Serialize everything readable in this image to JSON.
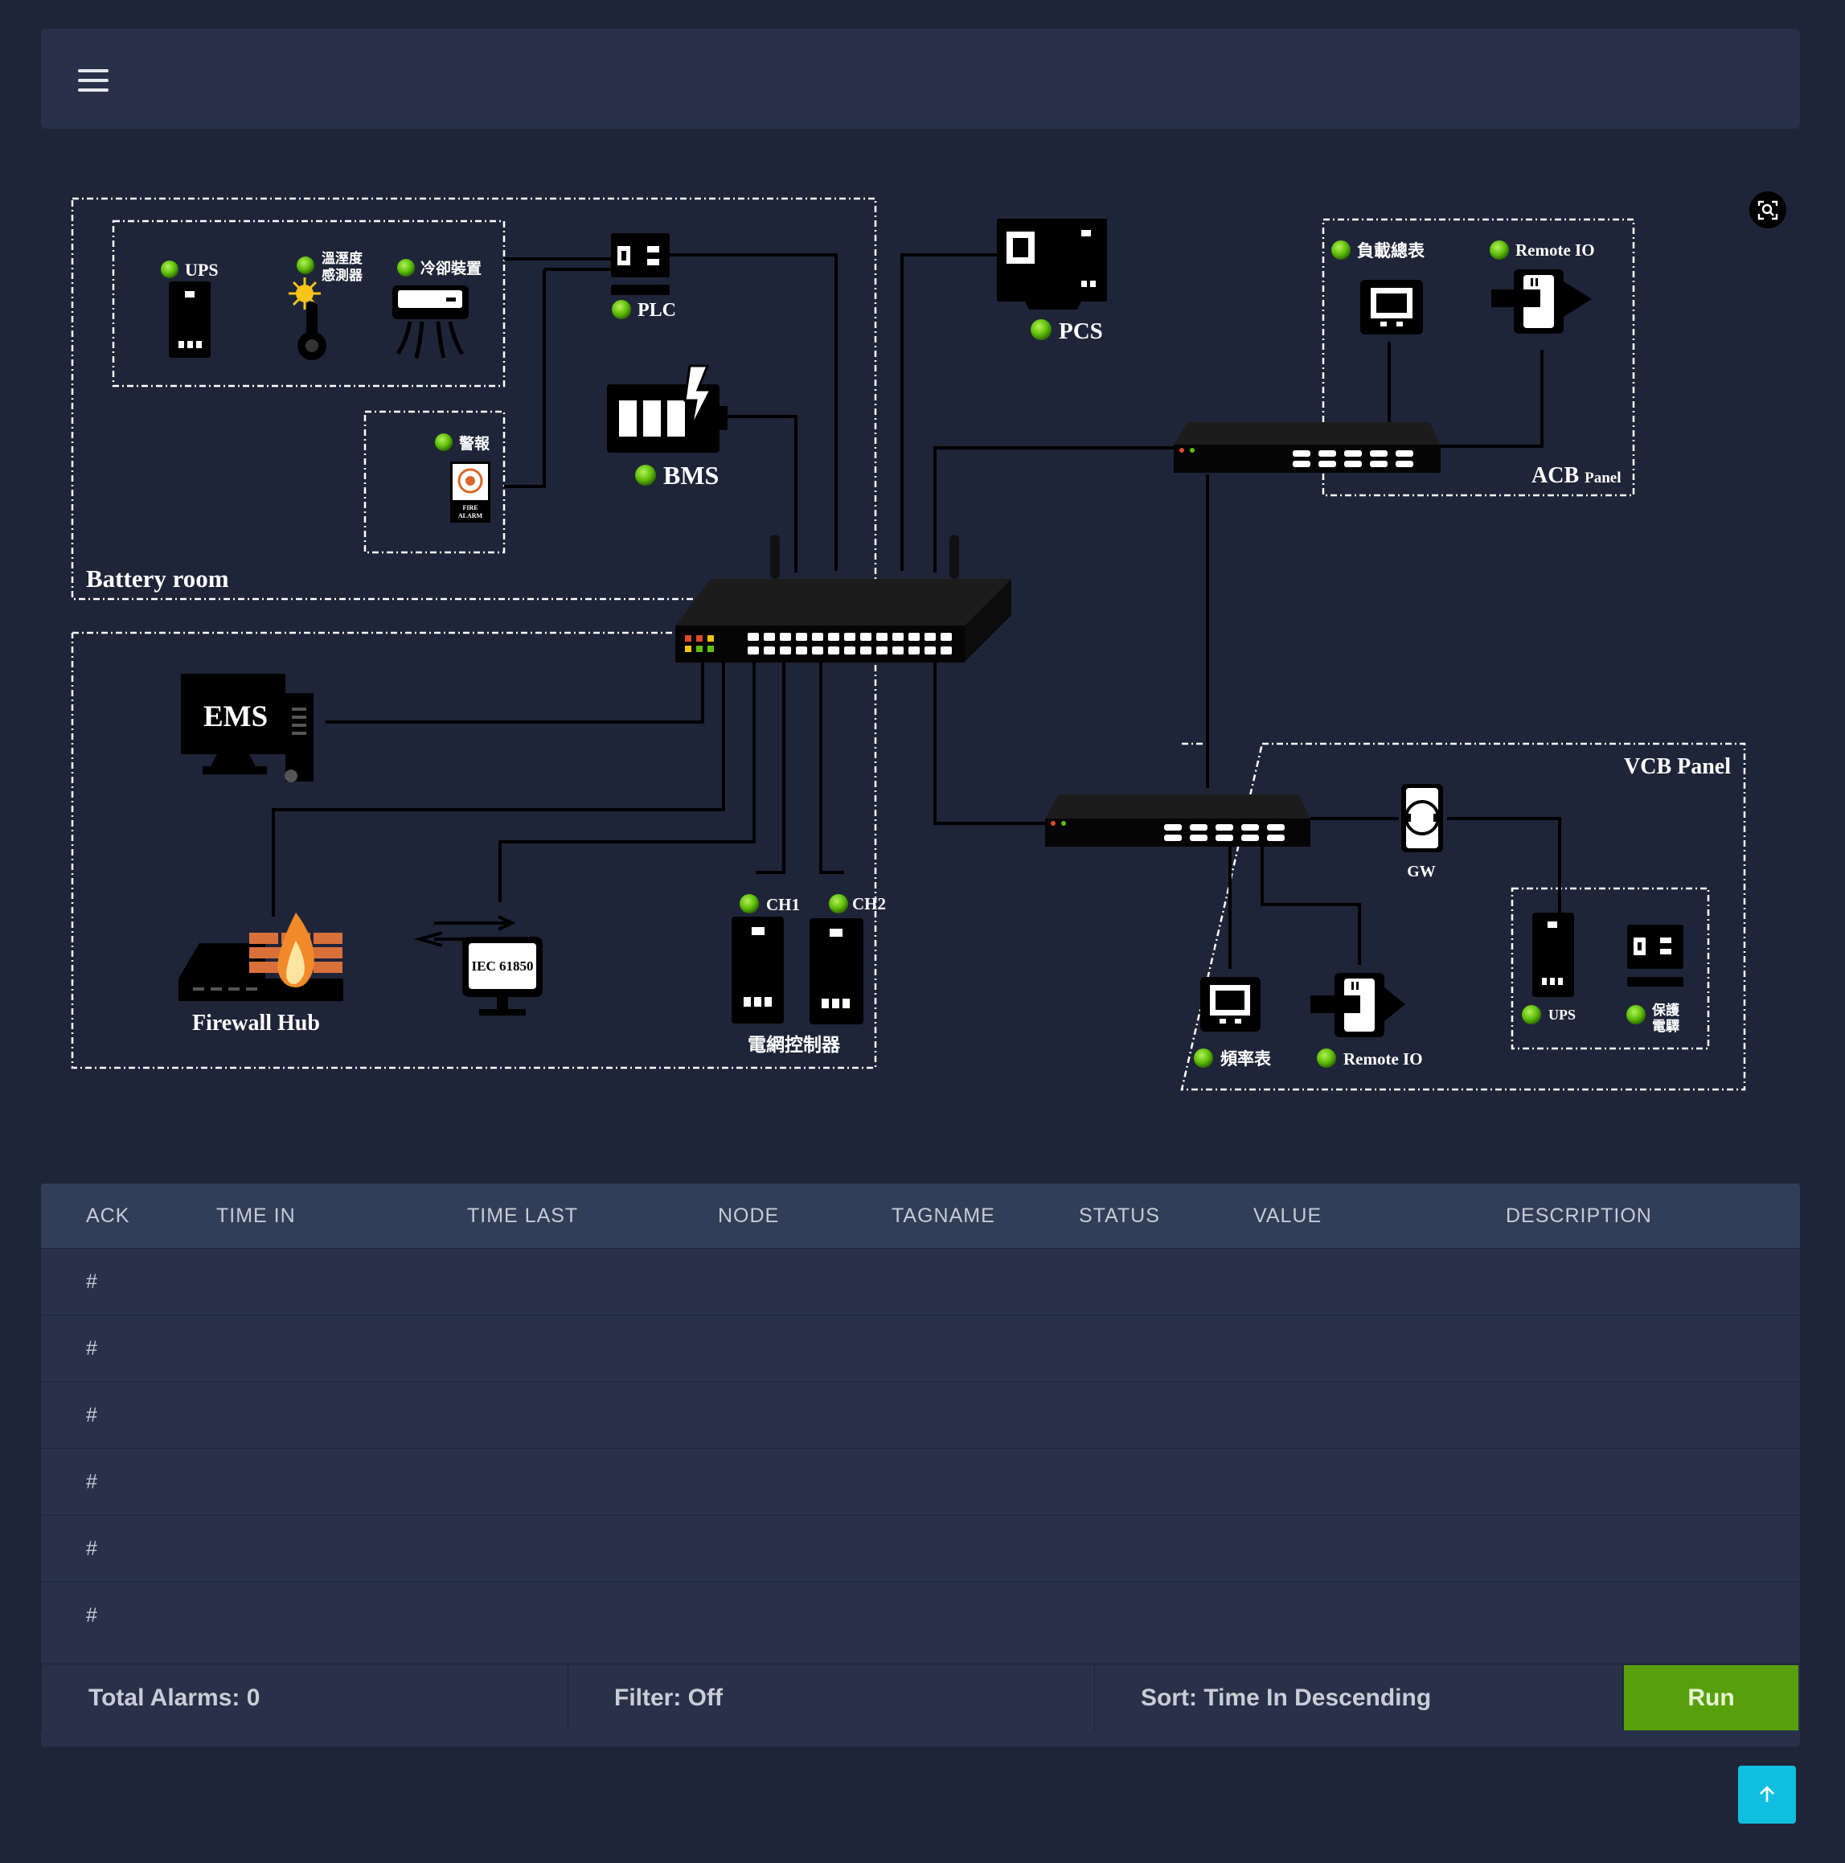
{
  "header": {
    "menu_icon": "hamburger-menu-icon"
  },
  "diagram": {
    "zones": {
      "battery_room": "Battery room",
      "acb_panel_main": "ACB",
      "acb_panel_suffix": "Panel",
      "vcb_panel": "VCB Panel"
    },
    "devices": {
      "ups": "UPS",
      "temp_sensor_line1": "溫溼度",
      "temp_sensor_line2": "感測器",
      "cooling": "冷卻裝置",
      "plc": "PLC",
      "alarm": "警報",
      "fire_alarm_line1": "FIRE",
      "fire_alarm_line2": "ALARM",
      "bms": "BMS",
      "pcs": "PCS",
      "load_meter": "負載總表",
      "remote_io_acb": "Remote IO",
      "ems": "EMS",
      "firewall_hub": "Firewall Hub",
      "iec": "IEC 61850",
      "ch1": "CH1",
      "ch2": "CH2",
      "grid_controller": "電網控制器",
      "gw": "GW",
      "vcb_ups": "UPS",
      "protection_line1": "保護",
      "protection_line2": "電驛",
      "freq_meter": "頻率表",
      "remote_io_vcb": "Remote IO"
    },
    "status_color": "#5fbf0a",
    "scan_icon": "scan-search-icon"
  },
  "alarm_table": {
    "columns": [
      "ACK",
      "TIME IN",
      "TIME LAST",
      "NODE",
      "TAGNAME",
      "STATUS",
      "VALUE",
      "DESCRIPTION"
    ],
    "rows": [
      {
        "ack": "#"
      },
      {
        "ack": "#"
      },
      {
        "ack": "#"
      },
      {
        "ack": "#"
      },
      {
        "ack": "#"
      },
      {
        "ack": "#"
      }
    ]
  },
  "footer": {
    "total_alarms": "Total Alarms: 0",
    "filter": "Filter: Off",
    "sort": "Sort: Time In Descending",
    "run_label": "Run",
    "run_color": "#58a00b"
  },
  "scroll_top_icon": "arrow-up-icon"
}
